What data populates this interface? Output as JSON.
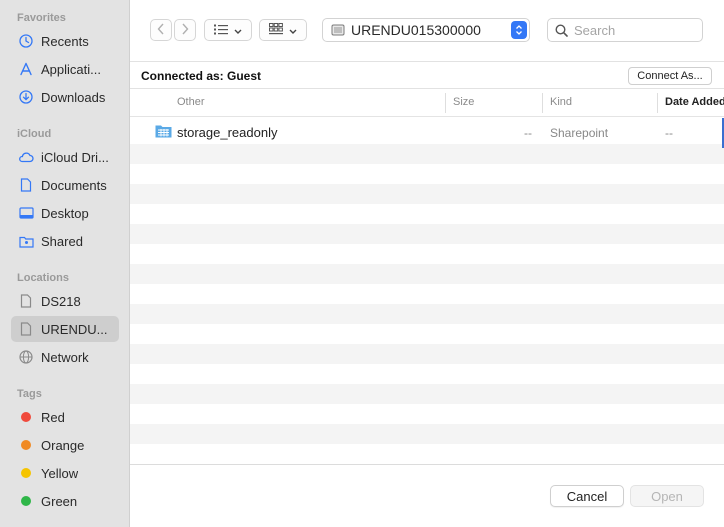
{
  "sidebar": {
    "favorites_heading": "Favorites",
    "favorites": [
      {
        "label": "Recents",
        "icon": "clock-icon"
      },
      {
        "label": "Applicati...",
        "icon": "applications-icon"
      },
      {
        "label": "Downloads",
        "icon": "download-icon"
      }
    ],
    "icloud_heading": "iCloud",
    "icloud": [
      {
        "label": "iCloud Dri...",
        "icon": "cloud-icon"
      },
      {
        "label": "Documents",
        "icon": "document-icon"
      },
      {
        "label": "Desktop",
        "icon": "desktop-icon"
      },
      {
        "label": "Shared",
        "icon": "shared-folder-icon"
      }
    ],
    "locations_heading": "Locations",
    "locations": [
      {
        "label": "DS218",
        "icon": "document-icon"
      },
      {
        "label": "URENDU...",
        "icon": "document-icon",
        "selected": true
      },
      {
        "label": "Network",
        "icon": "globe-icon"
      }
    ],
    "tags_heading": "Tags",
    "tags": [
      {
        "label": "Red",
        "color": "#f04a3c"
      },
      {
        "label": "Orange",
        "color": "#f08a24"
      },
      {
        "label": "Yellow",
        "color": "#f5c400"
      },
      {
        "label": "Green",
        "color": "#2fb648"
      }
    ]
  },
  "toolbar": {
    "location": "URENDU015300000",
    "search_placeholder": "Search"
  },
  "connection": {
    "label": "Connected as: Guest",
    "button": "Connect As..."
  },
  "columns": {
    "name": "Other",
    "size": "Size",
    "kind": "Kind",
    "date": "Date Added"
  },
  "files": [
    {
      "name": "storage_readonly",
      "size": "--",
      "kind": "Sharepoint",
      "date": "--"
    }
  ],
  "footer": {
    "cancel": "Cancel",
    "open": "Open"
  },
  "colors": {
    "accent": "#3478f6",
    "folder": "#5aa9e6"
  }
}
